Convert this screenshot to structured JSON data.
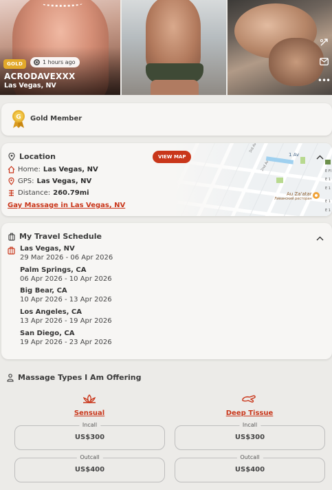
{
  "profile": {
    "badge": "GOLD",
    "last_active": "1 hours ago",
    "name": "ACRODAVEXXX",
    "city": "Las Vegas, NV"
  },
  "side_icons": [
    "share-icon",
    "mail-icon",
    "more-icon"
  ],
  "membership": {
    "label": "Gold Member"
  },
  "location": {
    "title": "Location",
    "view_map": "VIEW MAP",
    "home_label": "Home:",
    "home_value": "Las Vegas, NV",
    "gps_label": "GPS:",
    "gps_value": "Las Vegas, NV",
    "distance_label": "Distance:",
    "distance_value": "260.79mi",
    "link": "Gay Massage in Las Vegas, NV",
    "map_labels": [
      "1 Av",
      "Au Za'atar",
      "Ливанский ресторан",
      "E Fl",
      "E 1",
      "E 1",
      "E 1",
      "E 1",
      "3rd Av",
      "2nd Av"
    ]
  },
  "travel": {
    "title": "My Travel Schedule",
    "trips": [
      {
        "city": "Las Vegas, NV",
        "dates": "29 Mar 2026 - 06 Apr 2026"
      },
      {
        "city": "Palm Springs, CA",
        "dates": "06 Apr 2026 - 10 Apr 2026"
      },
      {
        "city": "Big Bear, CA",
        "dates": "10 Apr 2026 - 13 Apr 2026"
      },
      {
        "city": "Los Angeles, CA",
        "dates": "13 Apr 2026 - 19 Apr 2026"
      },
      {
        "city": "San Diego, CA",
        "dates": "19 Apr 2026 - 23 Apr 2026"
      }
    ]
  },
  "massage": {
    "title": "Massage Types I Am Offering",
    "types": [
      {
        "name": "Sensual",
        "incall_label": "Incall",
        "incall": "US$300",
        "outcall_label": "Outcall",
        "outcall": "US$400"
      },
      {
        "name": "Deep Tissue",
        "incall_label": "Incall",
        "incall": "US$300",
        "outcall_label": "Outcall",
        "outcall": "US$400"
      }
    ]
  },
  "colors": {
    "accent": "#c9361a",
    "gold": "#e2a92a"
  }
}
